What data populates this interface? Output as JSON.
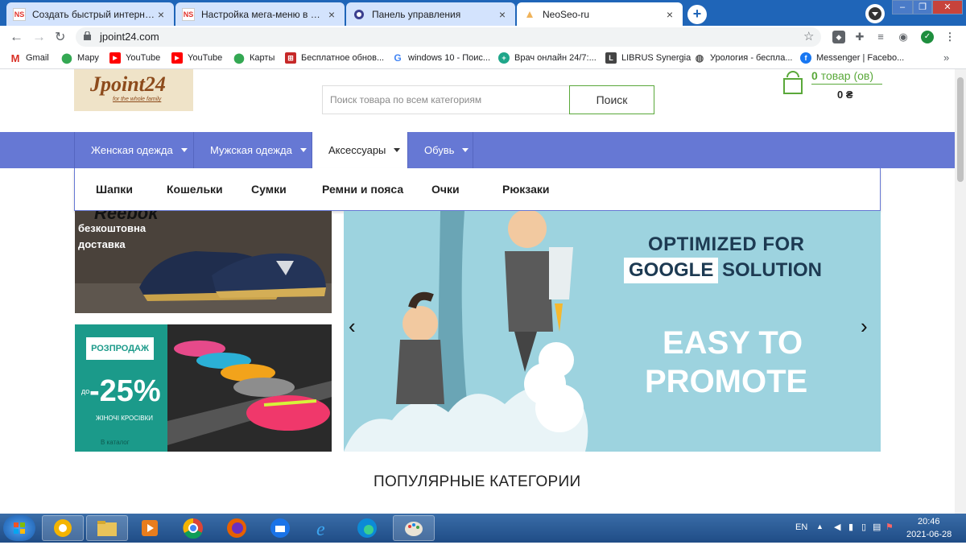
{
  "browser": {
    "tabs": [
      {
        "title": "Создать быстрый интернет-маг",
        "icon": "ns"
      },
      {
        "title": "Настройка мега-меню в модуле",
        "icon": "ns"
      },
      {
        "title": "Панель управления",
        "icon": "globe"
      },
      {
        "title": "NeoSeo-ru",
        "icon": "loading"
      }
    ],
    "address": "jpoint24.com",
    "bookmarks": [
      {
        "label": "Gmail",
        "icon": "gmail"
      },
      {
        "label": "Мару",
        "icon": "maps"
      },
      {
        "label": "YouTube",
        "icon": "youtube"
      },
      {
        "label": "YouTube",
        "icon": "youtube"
      },
      {
        "label": "Карты",
        "icon": "maps"
      },
      {
        "label": "Бесплатное обнов...",
        "icon": "update"
      },
      {
        "label": "windows 10 - Поис...",
        "icon": "google"
      },
      {
        "label": "Врач онлайн 24/7:...",
        "icon": "doctor"
      },
      {
        "label": "LIBRUS Synergia",
        "icon": "librus"
      },
      {
        "label": "Урология - беспла...",
        "icon": "globe"
      },
      {
        "label": "Messenger | Facebo...",
        "icon": "facebook"
      }
    ]
  },
  "site": {
    "logo_text": "Jpoint24",
    "logo_sub": "for the whole family",
    "search_placeholder": "Поиск товара по всем категориям",
    "search_button": "Поиск",
    "cart_count": "0",
    "cart_label": "товар (ов)",
    "cart_total": "0 ₴",
    "menu": [
      {
        "label": "Женская одежда",
        "open": false
      },
      {
        "label": "Мужская одежда",
        "open": false
      },
      {
        "label": "Аксессуары",
        "open": true
      },
      {
        "label": "Обувь",
        "open": false
      }
    ],
    "submenu": [
      "Шапки",
      "Кошельки",
      "Сумки",
      "Ремни и пояса",
      "Очки",
      "Рюкзаки"
    ],
    "banner_reebok": {
      "brand": "Reebok",
      "line1": "безкоштовна",
      "line2": "доставка"
    },
    "banner_sale": {
      "badge": "РОЗПРОДАЖ",
      "prefix": "до",
      "discount": "-25%",
      "caption": "ЖІНОЧІ КРОСІВКИ",
      "link": "В каталог"
    },
    "slider": {
      "line1": "OPTIMIZED FOR",
      "line2a": "GOOGLE",
      "line2b": "SOLUTION",
      "line3": "EASY TO",
      "line4": "PROMOTE"
    },
    "popular_title": "ПОПУЛЯРНЫЕ КАТЕГОРИИ"
  },
  "taskbar": {
    "lang": "EN",
    "time": "20:46",
    "date": "2021-06-28"
  }
}
